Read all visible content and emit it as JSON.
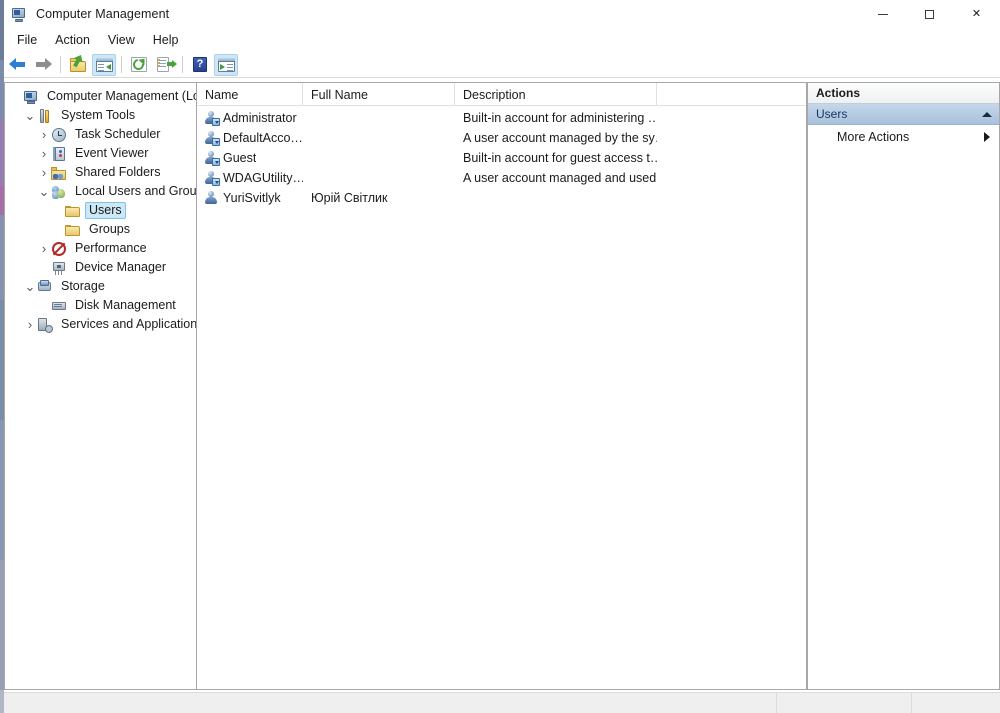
{
  "window": {
    "title": "Computer Management",
    "icon": "computer-management-icon",
    "controls": {
      "minimize": "—",
      "maximize": "□",
      "close": "✕"
    }
  },
  "menubar": {
    "items": [
      {
        "label": "File"
      },
      {
        "label": "Action"
      },
      {
        "label": "View"
      },
      {
        "label": "Help"
      }
    ]
  },
  "toolbar": {
    "buttons": [
      {
        "name": "back-button",
        "icon": "back-arrow-icon",
        "enabled": true
      },
      {
        "name": "forward-button",
        "icon": "forward-arrow-icon",
        "enabled": false
      },
      {
        "name": "up-one-level-button",
        "icon": "folder-up-icon",
        "enabled": true
      },
      {
        "name": "show-hide-console-tree-button",
        "icon": "console-tree-icon",
        "pressed": true
      },
      {
        "name": "refresh-button",
        "icon": "refresh-icon",
        "enabled": true
      },
      {
        "name": "export-list-button",
        "icon": "export-list-icon",
        "enabled": true
      },
      {
        "name": "help-button",
        "icon": "help-icon",
        "enabled": true
      },
      {
        "name": "show-hide-action-pane-button",
        "icon": "action-pane-icon",
        "pressed": true
      }
    ],
    "help_glyph": "?"
  },
  "tree": {
    "nodes": [
      {
        "label": "Computer Management (Local)",
        "icon": "computer-icon",
        "indent": 0,
        "chevron": "none",
        "selected": false
      },
      {
        "label": "System Tools",
        "icon": "system-tools-icon",
        "indent": 1,
        "chevron": "expanded",
        "selected": false
      },
      {
        "label": "Task Scheduler",
        "icon": "task-scheduler-icon",
        "indent": 2,
        "chevron": "collapsed",
        "selected": false
      },
      {
        "label": "Event Viewer",
        "icon": "event-viewer-icon",
        "indent": 2,
        "chevron": "collapsed",
        "selected": false
      },
      {
        "label": "Shared Folders",
        "icon": "shared-folders-icon",
        "indent": 2,
        "chevron": "collapsed",
        "selected": false
      },
      {
        "label": "Local Users and Groups",
        "icon": "local-users-groups-icon",
        "indent": 2,
        "chevron": "expanded",
        "selected": false
      },
      {
        "label": "Users",
        "icon": "folder-icon",
        "indent": 3,
        "chevron": "none",
        "selected": true
      },
      {
        "label": "Groups",
        "icon": "folder-icon",
        "indent": 3,
        "chevron": "none",
        "selected": false
      },
      {
        "label": "Performance",
        "icon": "performance-icon",
        "indent": 2,
        "chevron": "collapsed",
        "selected": false
      },
      {
        "label": "Device Manager",
        "icon": "device-manager-icon",
        "indent": 2,
        "chevron": "none",
        "selected": false
      },
      {
        "label": "Storage",
        "icon": "storage-icon",
        "indent": 1,
        "chevron": "expanded",
        "selected": false
      },
      {
        "label": "Disk Management",
        "icon": "disk-management-icon",
        "indent": 2,
        "chevron": "none",
        "selected": false
      },
      {
        "label": "Services and Applications",
        "icon": "services-apps-icon",
        "indent": 1,
        "chevron": "collapsed",
        "selected": false
      }
    ],
    "chevron_glyphs": {
      "expanded": "⌄",
      "collapsed": "›"
    }
  },
  "list": {
    "columns": [
      {
        "label": "Name"
      },
      {
        "label": "Full Name"
      },
      {
        "label": "Description"
      }
    ],
    "rows": [
      {
        "icon": "user-disabled-icon",
        "name": "Administrator",
        "full_name": "",
        "description": "Built-in account for administering …"
      },
      {
        "icon": "user-disabled-icon",
        "name": "DefaultAcco…",
        "full_name": "",
        "description": "A user account managed by the sy…"
      },
      {
        "icon": "user-disabled-icon",
        "name": "Guest",
        "full_name": "",
        "description": "Built-in account for guest access t…"
      },
      {
        "icon": "user-disabled-icon",
        "name": "WDAGUtility…",
        "full_name": "",
        "description": "A user account managed and used…"
      },
      {
        "icon": "user-icon",
        "name": "YuriSvitlyk",
        "full_name": "Юрій Світлик",
        "description": ""
      }
    ]
  },
  "actions": {
    "title": "Actions",
    "group": {
      "label": "Users",
      "collapse_icon": "triangle-up-icon"
    },
    "items": [
      {
        "label": "More Actions",
        "submenu_icon": "triangle-right-icon"
      }
    ]
  },
  "statusbar": {
    "segments": [
      "",
      "",
      ""
    ]
  },
  "colors": {
    "selection_fill": "#cce8f7",
    "selection_border": "#7fc3e8",
    "actions_group_top": "#c5d7ea",
    "actions_group_bottom": "#a8c1dc",
    "toolbar_pressed": "#cfe6f7",
    "pane_border": "#a7a7a7",
    "statusbar_bg": "#efefef"
  }
}
